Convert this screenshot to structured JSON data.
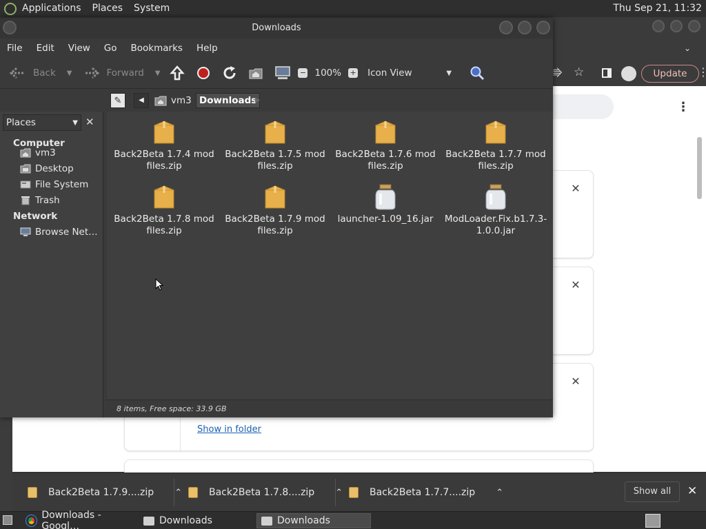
{
  "top_panel": {
    "menus": [
      "Applications",
      "Places",
      "System"
    ],
    "clock": "Thu Sep 21, 11:32"
  },
  "chrome": {
    "update_label": "Update",
    "show_in_folder": "Show in folder",
    "download_bar": {
      "items": [
        "Back2Beta 1.7.9....zip",
        "Back2Beta 1.7.8....zip",
        "Back2Beta 1.7.7....zip"
      ],
      "show_all": "Show all"
    }
  },
  "window": {
    "title": "Downloads",
    "menubar": [
      "File",
      "Edit",
      "View",
      "Go",
      "Bookmarks",
      "Help"
    ],
    "toolbar": {
      "back": "Back",
      "forward": "Forward",
      "zoom": "100%",
      "view_mode": "Icon View"
    },
    "breadcrumb": [
      "vm3",
      "Downloads"
    ],
    "sidebar": {
      "selector": "Places",
      "computer_heading": "Computer",
      "computer_items": [
        "vm3",
        "Desktop",
        "File System",
        "Trash"
      ],
      "network_heading": "Network",
      "network_items": [
        "Browse Net…"
      ]
    },
    "files": [
      {
        "line1": "Back2Beta 1.7.4 mod",
        "line2": "files.zip",
        "icon": "zip-archive-icon"
      },
      {
        "line1": "Back2Beta 1.7.5 mod",
        "line2": "files.zip",
        "icon": "zip-archive-icon"
      },
      {
        "line1": "Back2Beta 1.7.6 mod",
        "line2": "files.zip",
        "icon": "zip-archive-icon"
      },
      {
        "line1": "Back2Beta 1.7.7 mod",
        "line2": "files.zip",
        "icon": "zip-archive-icon"
      },
      {
        "line1": "Back2Beta 1.7.8 mod",
        "line2": "files.zip",
        "icon": "zip-archive-icon"
      },
      {
        "line1": "Back2Beta 1.7.9 mod",
        "line2": "files.zip",
        "icon": "zip-archive-icon"
      },
      {
        "line1": "launcher-1.09_16.jar",
        "line2": "",
        "icon": "jar-file-icon"
      },
      {
        "line1": "ModLoader.Fix.b1.7.3-",
        "line2": "1.0.0.jar",
        "icon": "jar-file-icon"
      }
    ],
    "status": "8 items, Free space: 33.9 GB"
  },
  "taskbar": {
    "items": [
      "Downloads - Googl…",
      "Downloads",
      "Downloads"
    ]
  }
}
